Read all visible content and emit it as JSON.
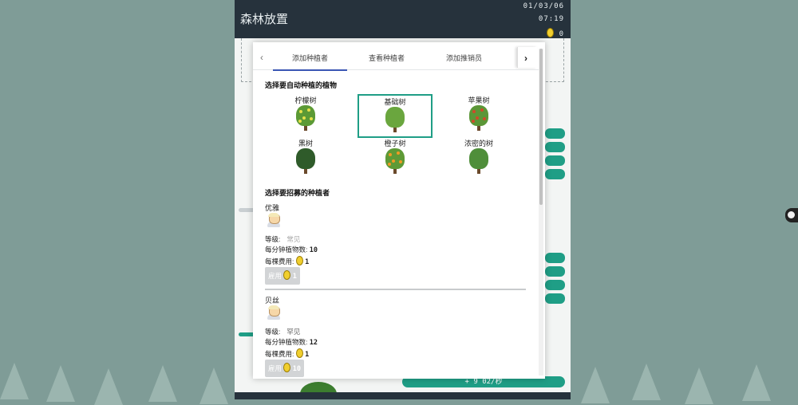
{
  "game": {
    "title": "森林放置",
    "date": "01/03/06",
    "time": "07:19",
    "coins": "0",
    "production_rate": "+ 9 02/秒"
  },
  "modal": {
    "tabs": [
      {
        "label": "添加种植者",
        "active": true
      },
      {
        "label": "查看种植者",
        "active": false
      },
      {
        "label": "添加推销员",
        "active": false
      }
    ],
    "plant_section_title": "选择要自动种植的植物",
    "plants": [
      {
        "name": "柠檬树",
        "selected": false,
        "crown": "#5c9a35",
        "fruit": "#e6e04a"
      },
      {
        "name": "基础树",
        "selected": true,
        "crown": "#6aa63e",
        "fruit": ""
      },
      {
        "name": "苹果树",
        "selected": false,
        "crown": "#5b9637",
        "fruit": "#d04a2a"
      },
      {
        "name": "黑树",
        "selected": false,
        "crown": "#2f5b2a",
        "fruit": ""
      },
      {
        "name": "橙子树",
        "selected": false,
        "crown": "#5e9a36",
        "fruit": "#f09a24"
      },
      {
        "name": "浓密的树",
        "selected": false,
        "crown": "#4f8e3a",
        "fruit": ""
      }
    ],
    "worker_section_title": "选择要招募的种植者",
    "labels": {
      "level": "等级:",
      "rate": "每分钟植物数:",
      "cost": "每棵费用:",
      "hire": "雇用"
    },
    "workers": [
      {
        "name": "优雅",
        "rarity": "常见",
        "rate": "10",
        "cost": "1",
        "hire_cost": "1"
      },
      {
        "name": "贝丝",
        "rarity": "罕见",
        "rate": "12",
        "cost": "1",
        "hire_cost": "10"
      }
    ]
  },
  "colors": {
    "accent": "#1f9e86",
    "tab_active": "#3a56b4",
    "topbar": "#26323c"
  }
}
